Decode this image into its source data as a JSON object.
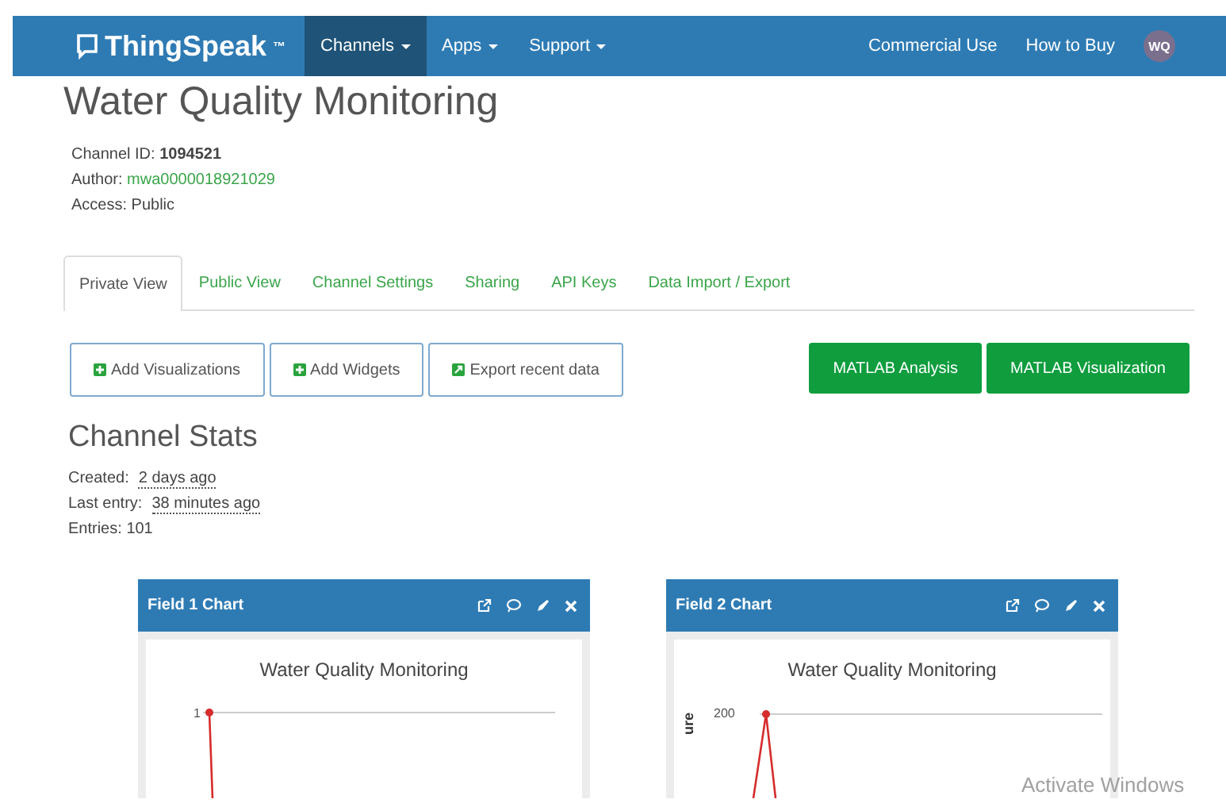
{
  "navbar": {
    "brand": "ThingSpeak$^{™}$",
    "menus": [
      {
        "label": "Channels",
        "selected": true
      },
      {
        "label": "Apps",
        "selected": false
      },
      {
        "label": "Support",
        "selected": false
      }
    ],
    "links": [
      "Commercial Use",
      "How to Buy"
    ],
    "avatar": "WQ"
  },
  "channel": {
    "title": "Water Quality Monitoring",
    "id_label": "Channel ID:",
    "id": "1094521",
    "author_label": "Author:",
    "author": "mwa0000018921029",
    "access": "Access: Public"
  },
  "tabs": [
    {
      "label": "Private View",
      "selected": true
    },
    {
      "label": "Public View",
      "selected": false
    },
    {
      "label": "Channel Settings",
      "selected": false
    },
    {
      "label": "Sharing",
      "selected": false
    },
    {
      "label": "API Keys",
      "selected": false
    },
    {
      "label": "Data Import / Export",
      "selected": false
    }
  ],
  "actions": [
    {
      "label": "Add Visualizations",
      "kind": "add"
    },
    {
      "label": "Add Widgets",
      "kind": "add"
    },
    {
      "label": "Export recent data",
      "kind": "export"
    }
  ],
  "matlab_buttons": [
    "MATLAB Analysis",
    "MATLAB Visualization"
  ],
  "stats": {
    "title": "Channel Stats",
    "rows": [
      {
        "label": "Created:",
        "value": "2 days ago",
        "kind": "time"
      },
      {
        "label": "Last entry:",
        "value": "38 minutes ago",
        "kind": "time"
      },
      {
        "label": "Entries:",
        "value": "101",
        "kind": "count"
      }
    ]
  },
  "charts": [
    {
      "title": "Field 1 Chart",
      "chart_title": "Water Quality Monitoring",
      "top_tick": "1"
    },
    {
      "title": "Field 2 Chart",
      "chart_title": "Water Quality Monitoring",
      "top_tick": "200",
      "axis_label": "ure"
    }
  ],
  "os_overlay": "Activate Windows"
}
